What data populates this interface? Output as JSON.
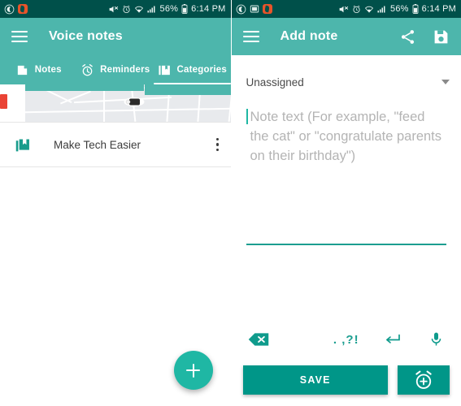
{
  "colors": {
    "status_bar": "#00504A",
    "app_bar": "#4DB6AC",
    "accent": "#009688",
    "fab": "#1FB7A4",
    "placeholder": "#B4B4B4"
  },
  "status_bar": {
    "left_icons": [
      "do-not-disturb-moon-icon",
      "screenshot-icon",
      "app-notification-icon"
    ],
    "mute_icon": "volume-mute-icon",
    "alarm_icon": "alarm-icon",
    "wifi_icon": "wifi-icon",
    "signal_icon": "cellular-signal-icon",
    "battery_text": "56%",
    "battery_icon": "battery-icon",
    "time": "6:14 PM"
  },
  "left_screen": {
    "app_bar": {
      "menu_icon": "hamburger-menu-icon",
      "title": "Voice notes"
    },
    "tabs": [
      {
        "label": "Notes",
        "icon": "note-icon",
        "selected": false
      },
      {
        "label": "Reminders",
        "icon": "alarm-clock-icon",
        "selected": false
      },
      {
        "label": "Categories",
        "icon": "collections-icon",
        "selected": true
      }
    ],
    "map_card": {
      "icon": "map-thumbnail",
      "marker": "car-marker-icon"
    },
    "list_items": [
      {
        "icon": "collections-bookmark-icon",
        "label": "Make Tech Easier",
        "overflow_icon": "more-vertical-icon"
      }
    ],
    "fab": {
      "icon": "plus-icon",
      "label": "+"
    }
  },
  "right_screen": {
    "app_bar": {
      "menu_icon": "hamburger-menu-icon",
      "title": "Add note",
      "share_icon": "share-icon",
      "save_icon": "floppy-save-icon"
    },
    "category_spinner": {
      "value": "Unassigned",
      "chevron_icon": "chevron-down-icon"
    },
    "note_input": {
      "value": "",
      "placeholder": "Note text (For example, \"feed the cat\" or \"congratulate parents on their birthday\")"
    },
    "keyboard_row": {
      "backspace_icon": "backspace-icon",
      "punctuation_label": ". ,?!",
      "enter_icon": "enter-return-icon",
      "mic_icon": "microphone-icon"
    },
    "actions": {
      "save_label": "SAVE",
      "alarm_icon": "add-alarm-icon"
    }
  }
}
